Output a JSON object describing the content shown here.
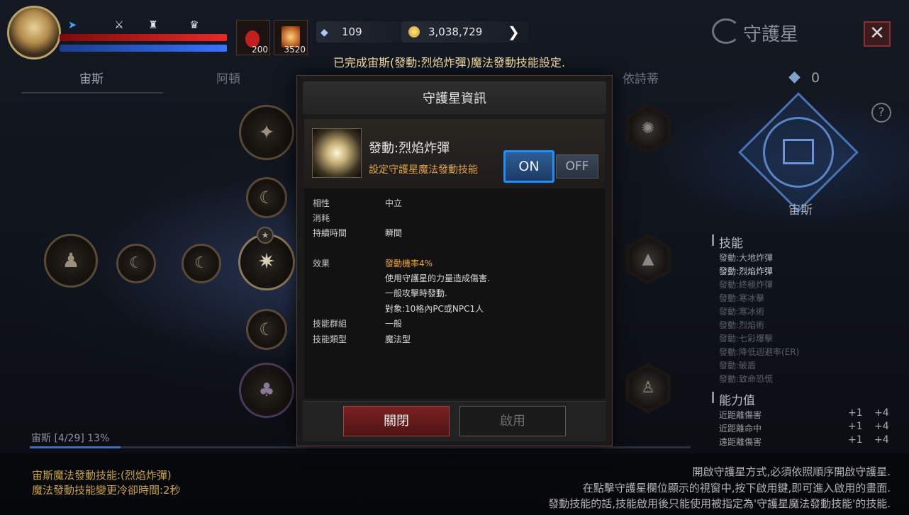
{
  "hud": {
    "potion_count": "200",
    "scroll_count": "3520",
    "crystals": "109",
    "gold": "3,038,729",
    "notice": "已完成宙斯(發動:烈焰炸彈)魔法發動技能設定."
  },
  "window": {
    "title": "守護星"
  },
  "tabs": [
    "宙斯",
    "阿頓",
    "依詩蒂"
  ],
  "point_count": "0",
  "guardian": {
    "name": "宙斯"
  },
  "dialog": {
    "title": "守護星資訊",
    "skill_name": "發動:烈焰炸彈",
    "skill_desc": "設定守護星魔法發動技能",
    "on": "ON",
    "off": "OFF",
    "rows": [
      {
        "label": "相性",
        "value": "中立"
      },
      {
        "label": "消耗",
        "value": ""
      },
      {
        "label": "持續時間",
        "value": "瞬間"
      }
    ],
    "effect_label": "效果",
    "effect_lines": [
      "發動機率4%",
      "使用守護星的力量造成傷害.",
      "一般攻擊時發動.",
      "對象:10格內PC或NPC1人"
    ],
    "group_label": "技能群組",
    "group_value": "一般",
    "type_label": "技能類型",
    "type_value": "魔法型",
    "close_btn": "關閉",
    "use_btn": "啟用"
  },
  "right_panel": {
    "skills_title": "技能",
    "skills": [
      "發動:大地炸彈",
      "發動:烈焰炸彈",
      "發動:終極炸彈",
      "發動:寒冰擊",
      "發動:寒冰術",
      "發動:烈焰術",
      "發動:七彩爆擊",
      "發動:降低迴避率(ER)",
      "發動:破盾",
      "發動:致命恐慌"
    ],
    "stats_title": "能力值",
    "stats": [
      {
        "label": "近距離傷害",
        "a": "+1",
        "b": "+4"
      },
      {
        "label": "近距離命中",
        "a": "+1",
        "b": "+4"
      },
      {
        "label": "遠距離傷害",
        "a": "+1",
        "b": "+4"
      }
    ]
  },
  "progress": {
    "label": "宙斯 [4/29] 13%",
    "fraction": 0.13
  },
  "bottom_left": [
    "宙斯魔法發動技能:(烈焰炸彈)",
    "魔法發動技能變更冷卻時間:2秒"
  ],
  "bottom_right": [
    "開啟守護星方式,必須依照順序開啟守護星.",
    "在點擊守護星欄位顯示的視窗中,按下啟用鍵,即可進入啟用的畫面.",
    "發動技能的話,技能啟用後只能使用被指定為'守護星魔法發動技能'的技能."
  ]
}
